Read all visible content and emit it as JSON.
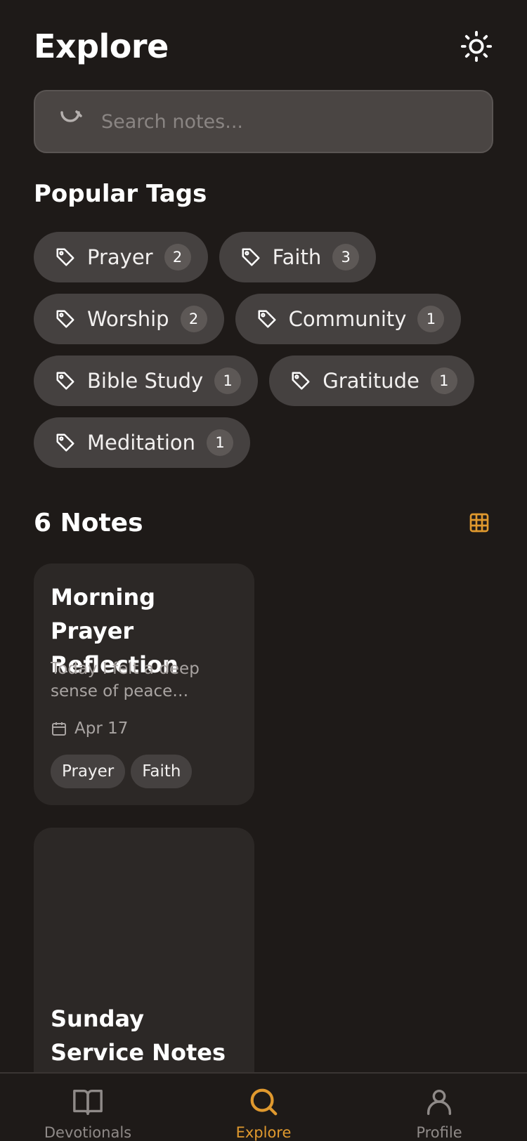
{
  "header": {
    "title": "Explore",
    "theme_icon": "sun-icon"
  },
  "search": {
    "placeholder": "Search notes...",
    "value": ""
  },
  "tags_section": {
    "heading": "Popular Tags",
    "tags": [
      {
        "label": "Prayer",
        "count": "2"
      },
      {
        "label": "Faith",
        "count": "3"
      },
      {
        "label": "Worship",
        "count": "2"
      },
      {
        "label": "Community",
        "count": "1"
      },
      {
        "label": "Bible Study",
        "count": "1"
      },
      {
        "label": "Gratitude",
        "count": "1"
      },
      {
        "label": "Meditation",
        "count": "1"
      }
    ]
  },
  "notes_section": {
    "heading": "6 Notes",
    "view_icon": "grid-icon",
    "notes": [
      {
        "title": "Morning Prayer Reflection",
        "excerpt": "Today I felt a deep sense of peace during...",
        "date": "Apr 17",
        "tags": [
          "Prayer",
          "Faith"
        ]
      },
      {
        "title": "Sunday Service Notes"
      }
    ]
  },
  "bottom_nav": {
    "items": [
      {
        "label": "Devotionals",
        "icon": "book-icon",
        "active": false
      },
      {
        "label": "Explore",
        "icon": "search-icon",
        "active": true
      },
      {
        "label": "Profile",
        "icon": "user-icon",
        "active": false
      }
    ]
  },
  "colors": {
    "accent": "#e0992e",
    "background": "#1e1a18",
    "card": "#2c2826",
    "chip": "#454140"
  }
}
